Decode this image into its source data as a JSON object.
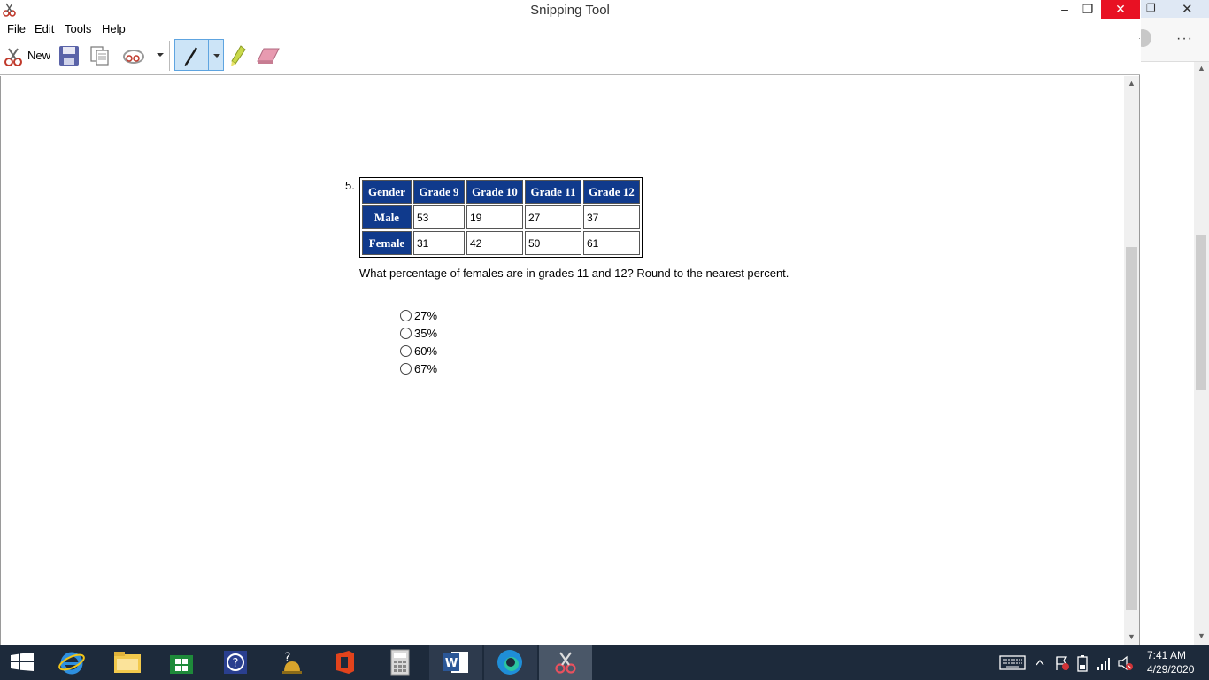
{
  "window": {
    "title": "Snipping Tool",
    "minimize": "–",
    "maximize": "❐",
    "close": "✕"
  },
  "menu": {
    "file": "File",
    "edit": "Edit",
    "tools": "Tools",
    "help": "Help"
  },
  "toolbar": {
    "new_label": "New"
  },
  "content": {
    "question_number": "5.",
    "table": {
      "headers": [
        "Gender",
        "Grade 9",
        "Grade 10",
        "Grade 11",
        "Grade 12"
      ],
      "rows": [
        {
          "label": "Male",
          "values": [
            "53",
            "19",
            "27",
            "37"
          ]
        },
        {
          "label": "Female",
          "values": [
            "31",
            "42",
            "50",
            "61"
          ]
        }
      ]
    },
    "question": "What percentage of females are in grades 11 and 12? Round to the nearest percent.",
    "options": [
      "27%",
      "35%",
      "60%",
      "67%"
    ]
  },
  "browser": {
    "restore": "❐",
    "close": "✕",
    "more": "···"
  },
  "clock": {
    "time": "7:41 AM",
    "date": "4/29/2020"
  },
  "colors": {
    "header_bg": "#103a8c",
    "taskbar": "#1d2a3b",
    "close_red": "#e81123"
  }
}
